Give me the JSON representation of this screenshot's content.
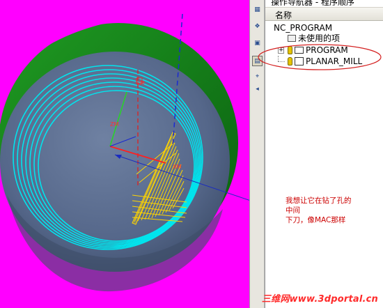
{
  "navigator": {
    "title": "操作导航器 - 程序顺序",
    "column_header": "名称",
    "tree": [
      {
        "label": "NC_PROGRAM",
        "level": 0
      },
      {
        "label": "未使用的项",
        "level": 1
      },
      {
        "label": "PROGRAM",
        "level": 1,
        "expander": "+"
      },
      {
        "label": "PLANAR_MILL",
        "level": 2
      }
    ]
  },
  "viewport": {
    "axis_labels": {
      "zm": "ZM",
      "xm": "XM",
      "ym": "YM"
    }
  },
  "annotation": {
    "text_line1": "我想让它在钻了孔的中间",
    "text_line2": "下刀，像MAC那样"
  },
  "watermark": {
    "text": "三维网www.3dportal.cn"
  },
  "colors": {
    "background_magenta": "#ff00ff",
    "part_face": "#5c6e8e",
    "wall_green": "#0f7a12",
    "toolpath_cyan": "#00e5ee",
    "toolpath_yellow": "#ffd400",
    "annotation_red": "#cc0000",
    "callout_blue": "#1a2cc0"
  }
}
